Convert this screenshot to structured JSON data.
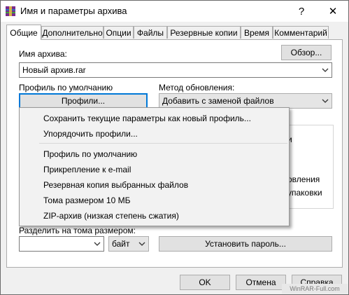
{
  "window": {
    "title": "Имя и параметры архива",
    "help_label": "?",
    "close_label": "✕"
  },
  "tabs": [
    {
      "label": "Общие",
      "active": true
    },
    {
      "label": "Дополнительно",
      "active": false
    },
    {
      "label": "Опции",
      "active": false
    },
    {
      "label": "Файлы",
      "active": false
    },
    {
      "label": "Резервные копии",
      "active": false
    },
    {
      "label": "Время",
      "active": false
    },
    {
      "label": "Комментарий",
      "active": false
    }
  ],
  "general": {
    "archive_name_label": "Имя архива:",
    "browse_button": "Обзор...",
    "archive_name_value": "Новый архив.rar",
    "default_profile_label": "Профиль по умолчанию",
    "profiles_button": "Профили...",
    "update_method_label": "Метод обновления:",
    "update_method_value": "Добавить с заменой файлов",
    "partial_text_1": "и",
    "partial_text_2": "овления",
    "partial_text_3": "упаковки",
    "split_label": "Разделить на тома размером:",
    "split_value": "",
    "split_unit": "байт",
    "set_password_button": "Установить пароль..."
  },
  "profiles_menu": {
    "items_top": [
      "Сохранить текущие параметры как новый профиль...",
      "Упорядочить профили..."
    ],
    "items_bottom": [
      "Профиль по умолчанию",
      "Прикрепление к e-mail",
      "Резервная копия выбранных файлов",
      "Тома размером 10 МБ",
      "ZIP-архив (низкая степень сжатия)"
    ]
  },
  "footer": {
    "ok_button": "OK",
    "cancel_button": "Отмена",
    "help_button": "Справка"
  },
  "watermark": {
    "text": "WinRAR-Full.com"
  },
  "colors": {
    "accent": "#0078d7",
    "window_bg": "#f0f0f0",
    "panel_bg": "#ffffff"
  }
}
